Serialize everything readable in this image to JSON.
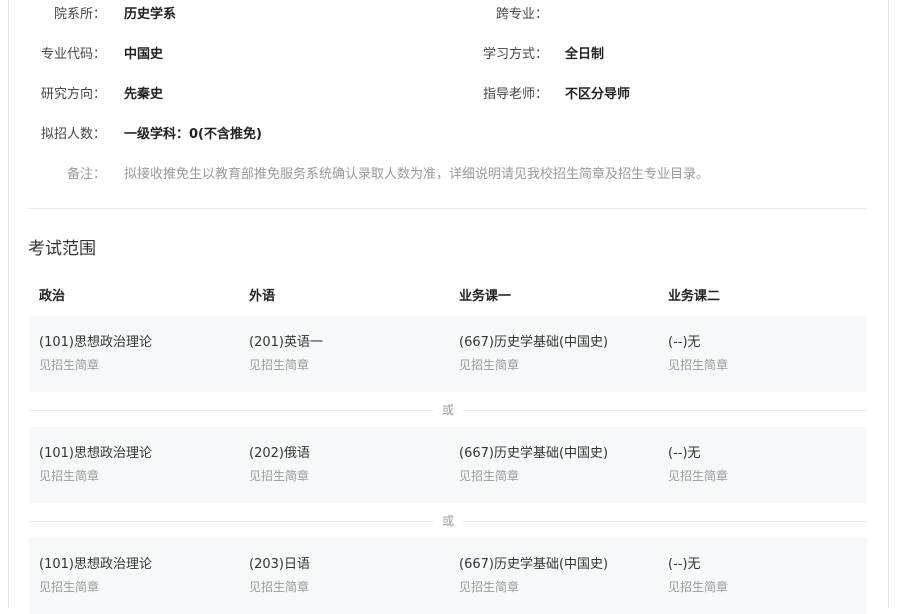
{
  "info": {
    "dept_label": "院系所：",
    "dept_value": "历史学系",
    "cross_label": "跨专业：",
    "cross_value": "",
    "code_label": "专业代码：",
    "code_value": "中国史",
    "mode_label": "学习方式：",
    "mode_value": "全日制",
    "direction_label": "研究方向：",
    "direction_value": "先秦史",
    "advisor_label": "指导老师：",
    "advisor_value": "不区分导师",
    "quota_label": "拟招人数：",
    "quota_value": "一级学科：0(不含推免)",
    "note_label": "备注：",
    "note_value": "拟接收推免生以教育部推免服务系统确认录取人数为准，详细说明请见我校招生简章及招生专业目录。"
  },
  "exam": {
    "title": "考试范围",
    "headers": [
      "政治",
      "外语",
      "业务课一",
      "业务课二"
    ],
    "or_text": "或",
    "options": [
      [
        {
          "name": "(101)思想政治理论",
          "sub": "见招生简章"
        },
        {
          "name": "(201)英语一",
          "sub": "见招生简章"
        },
        {
          "name": "(667)历史学基础(中国史)",
          "sub": "见招生简章"
        },
        {
          "name": "(--)无",
          "sub": "见招生简章"
        }
      ],
      [
        {
          "name": "(101)思想政治理论",
          "sub": "见招生简章"
        },
        {
          "name": "(202)俄语",
          "sub": "见招生简章"
        },
        {
          "name": "(667)历史学基础(中国史)",
          "sub": "见招生简章"
        },
        {
          "name": "(--)无",
          "sub": "见招生简章"
        }
      ],
      [
        {
          "name": "(101)思想政治理论",
          "sub": "见招生简章"
        },
        {
          "name": "(203)日语",
          "sub": "见招生简章"
        },
        {
          "name": "(667)历史学基础(中国史)",
          "sub": "见招生简章"
        },
        {
          "name": "(--)无",
          "sub": "见招生简章"
        }
      ]
    ]
  }
}
